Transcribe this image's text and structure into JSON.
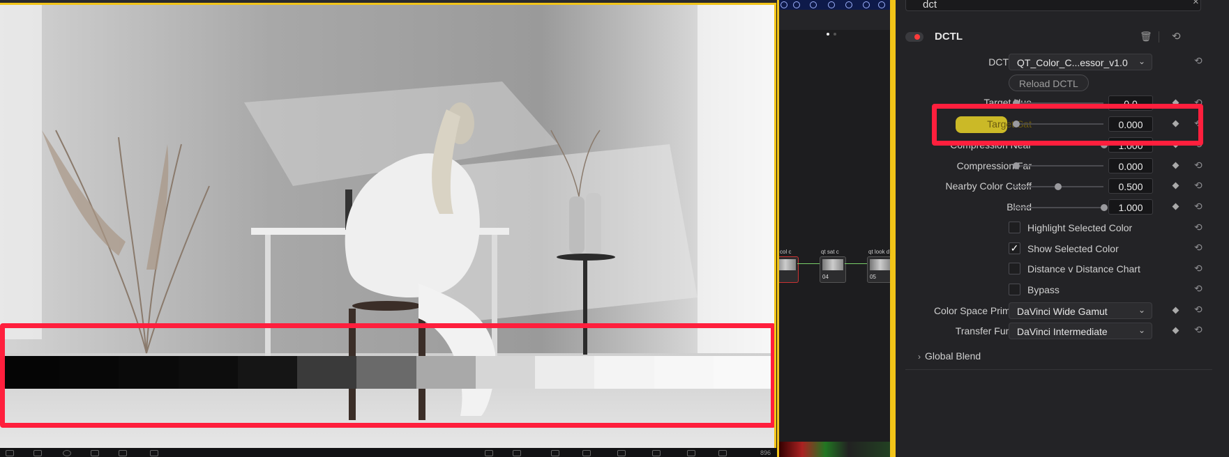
{
  "viewer": {
    "timecode": "896",
    "grayscale_ramp": [
      "#050505",
      "#070707",
      "#0a0a0a",
      "#0d0d0d",
      "#151515",
      "#3a3a3a",
      "#6a6a6a",
      "#a9a9a9",
      "#d6d6d6",
      "#ececec",
      "#f4f4f4",
      "#f7f7f7",
      "#f9f9f9"
    ]
  },
  "nodes": {
    "labels": [
      "col c",
      "qt sat c",
      "qt look d..."
    ],
    "numbers": [
      "",
      "04",
      "05"
    ]
  },
  "inspector": {
    "search_value": "dct",
    "search_clear": "×",
    "header_title": "DCTL",
    "rows": {
      "dctl_list_label": "DCTL List",
      "dctl_list_value": "QT_Color_C...essor_v1.0",
      "reload_label": "Reload DCTL",
      "target_hue_label": "Target Hue",
      "target_hue_value": "0.0",
      "target_sat_label": "Target Sat",
      "target_sat_value": "0.000",
      "compression_near_label": "Compression Near",
      "compression_near_value": "1.000",
      "compression_far_label": "Compression Far",
      "compression_far_value": "0.000",
      "nearby_cutoff_label": "Nearby Color Cutoff",
      "nearby_cutoff_value": "0.500",
      "blend_label": "Blend",
      "blend_value": "1.000",
      "highlight_label": "Highlight Selected Color",
      "show_selected_label": "Show Selected Color",
      "distance_chart_label": "Distance v Distance Chart",
      "bypass_label": "Bypass",
      "primaries_label": "Color Space Primaries",
      "primaries_value": "DaVinci Wide Gamut",
      "transfer_label": "Transfer Function",
      "transfer_value": "DaVinci Intermediate",
      "global_blend_label": "Global Blend"
    },
    "checks": {
      "highlight": false,
      "show_selected": true,
      "distance_chart": false,
      "bypass": false
    },
    "levels": {
      "target_sat": 0.0,
      "compression_far": 0.0,
      "nearby_cutoff": 0.5,
      "blend": 1.0
    }
  },
  "colors": {
    "accent_yellow": "#f2c418",
    "annotation_red": "#ff1f3d",
    "marker_yellow": "#e9d428"
  }
}
